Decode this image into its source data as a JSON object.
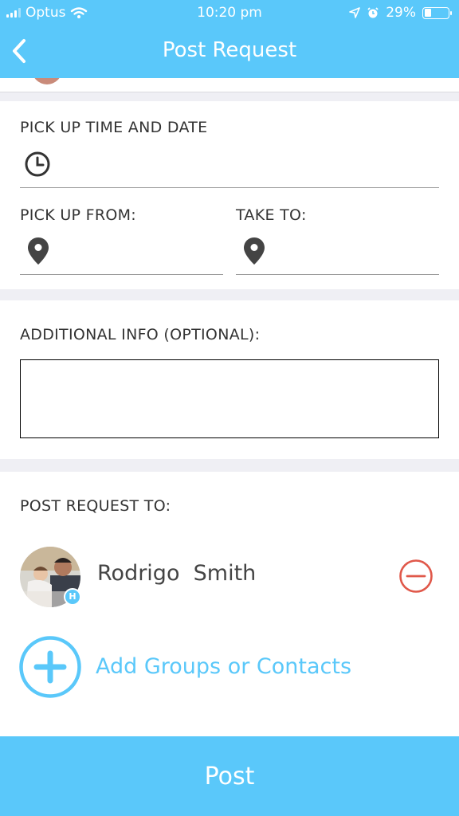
{
  "status_bar": {
    "carrier": "Optus",
    "time": "10:20 pm",
    "battery_percent": "29%",
    "battery_level": 0.29,
    "icons": [
      "signal-icon",
      "wifi-icon",
      "location-arrow-icon",
      "alarm-icon",
      "battery-icon"
    ]
  },
  "nav": {
    "title": "Post Request",
    "back_icon": "chevron-left-icon"
  },
  "pickup": {
    "time_label": "PICK UP TIME AND DATE",
    "time_icon": "clock-icon",
    "from_label": "PICK UP FROM:",
    "to_label": "TAKE TO:",
    "location_icon": "map-pin-icon"
  },
  "additional": {
    "label": "ADDITIONAL INFO (OPTIONAL):",
    "value": ""
  },
  "recipients": {
    "label": "POST REQUEST TO:",
    "contacts": [
      {
        "name": "Rodrigo  Smith",
        "badge": "H"
      }
    ],
    "remove_icon": "minus-circle-icon",
    "add_icon": "plus-circle-icon",
    "add_label": "Add Groups or Contacts"
  },
  "post_button": {
    "label": "Post"
  },
  "colors": {
    "accent": "#5ac8fa",
    "remove": "#e0584a",
    "background": "#efeff4"
  }
}
